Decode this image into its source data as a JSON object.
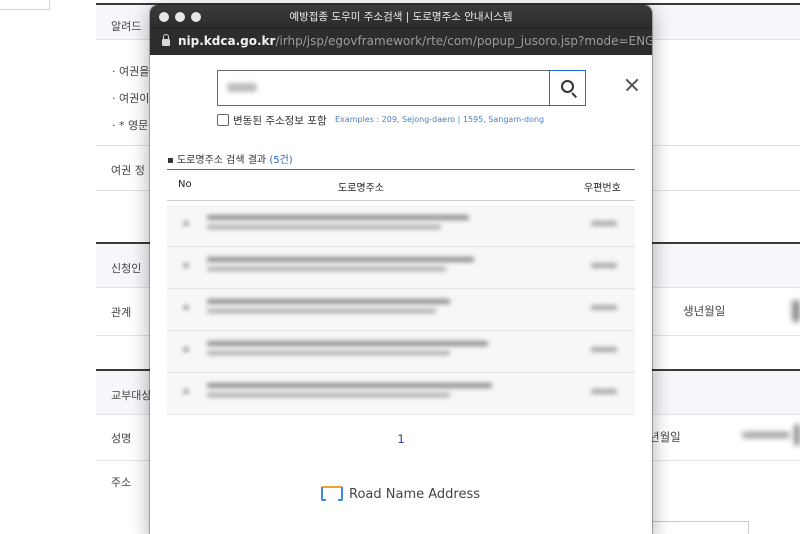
{
  "background": {
    "section_titles": [
      "알려드",
      "여권 정",
      "신청인",
      "관계",
      "교부대상",
      "성명",
      "주소"
    ],
    "bullets": [
      "· 여권을",
      "· 여권이",
      "· * 영문"
    ],
    "dob_label_1": "생년월일",
    "dob_label_2": "년월일"
  },
  "popup": {
    "window_title": "예방접종 도우미 주소검색 | 도로명주소 안내시스템",
    "url_host": "nip.kdca.go.kr",
    "url_path": "/irhp/jsp/egovframework/rte/com/popup_jusoro.jsp?mode=ENG",
    "search": {
      "value": "",
      "placeholder": ""
    },
    "include_changed_label": "변동된 주소정보 포함",
    "examples_text": "Examples : 209, Sejong-daero | 1595, Sangam-dong",
    "results": {
      "title": "도로명주소 검색 결과",
      "count": "(5건)",
      "columns": {
        "no": "No",
        "address": "도로명주소",
        "zip": "우편번호"
      },
      "rows": [
        {
          "addr1_width": 0.56,
          "addr2_width": 0.5
        },
        {
          "addr1_width": 0.57,
          "addr2_width": 0.51
        },
        {
          "addr1_width": 0.52,
          "addr2_width": 0.49
        },
        {
          "addr1_width": 0.6,
          "addr2_width": 0.52
        },
        {
          "addr1_width": 0.61,
          "addr2_width": 0.52
        }
      ]
    },
    "pagination": {
      "current_page": "1"
    },
    "footer_text": "Road Name Address"
  },
  "colors": {
    "accent_blue": "#1d6fd6",
    "count_blue": "#2c64c0",
    "page_number": "#2a3d96",
    "titlebar": "#2e2e2e"
  },
  "icons": {
    "search": "search-icon",
    "close": "close-icon",
    "lock": "lock-icon",
    "logo": "road-name-address-logo-icon"
  }
}
